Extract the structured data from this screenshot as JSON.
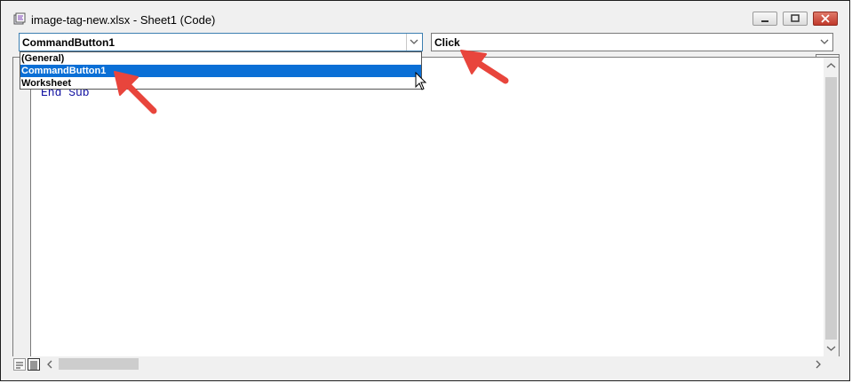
{
  "window": {
    "title": "image-tag-new.xlsx - Sheet1 (Code)"
  },
  "object_dropdown": {
    "value": "CommandButton1",
    "options": [
      "(General)",
      "CommandButton1",
      "Worksheet"
    ],
    "selected_option": "CommandButton1"
  },
  "procedure_dropdown": {
    "value": "Click"
  },
  "code": {
    "lines": [
      "End Sub"
    ]
  },
  "colors": {
    "selection": "#0a6fd6",
    "code_keyword": "#1010a0",
    "annotation_arrow": "#e8453c"
  },
  "icons": {
    "app": "vba-module-icon",
    "minimize": "minimize-icon",
    "maximize": "maximize-icon",
    "close": "close-icon"
  }
}
